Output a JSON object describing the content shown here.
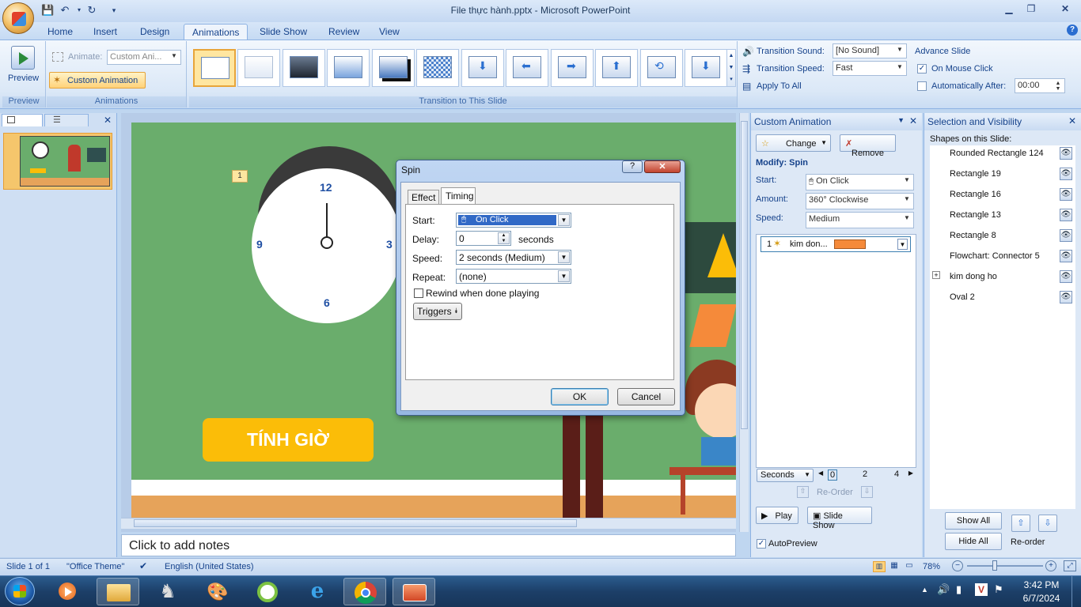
{
  "window": {
    "title": "File thực hành.pptx - Microsoft PowerPoint"
  },
  "tabs": [
    "Home",
    "Insert",
    "Design",
    "Animations",
    "Slide Show",
    "Review",
    "View"
  ],
  "ribbon": {
    "preview_label": "Preview",
    "preview_group": "Preview",
    "animate_label": "Animate:",
    "animate_value": "Custom Ani...",
    "custom_animation_label": "Custom Animation",
    "animations_group": "Animations",
    "transition_group": "Transition to This Slide",
    "transition_sound_label": "Transition Sound:",
    "transition_sound_value": "[No Sound]",
    "transition_speed_label": "Transition Speed:",
    "transition_speed_value": "Fast",
    "apply_all_label": "Apply To All",
    "advance_slide_label": "Advance Slide",
    "on_mouse_click_label": "On Mouse Click",
    "auto_after_label": "Automatically After:",
    "auto_after_value": "00:00"
  },
  "slide_panel": {
    "slide_number": "1"
  },
  "slide": {
    "marker": "1",
    "clock_numbers": {
      "n12": "12",
      "n3": "3",
      "n6": "6",
      "n9": "9"
    },
    "button_text": "TÍNH GIỜ"
  },
  "notes": {
    "placeholder": "Click to add notes"
  },
  "dialog": {
    "title": "Spin",
    "tab_effect": "Effect",
    "tab_timing": "Timing",
    "start_label": "Start:",
    "start_value": "On Click",
    "delay_label": "Delay:",
    "delay_value": "0",
    "delay_unit": "seconds",
    "speed_label": "Speed:",
    "speed_value": "2 seconds (Medium)",
    "repeat_label": "Repeat:",
    "repeat_value": "(none)",
    "rewind_label": "Rewind when done playing",
    "triggers_label": "Triggers",
    "ok_label": "OK",
    "cancel_label": "Cancel"
  },
  "custom_animation": {
    "header": "Custom Animation",
    "change_label": "Change",
    "remove_label": "Remove",
    "modify_label": "Modify: Spin",
    "start_label": "Start:",
    "start_value": "On Click",
    "amount_label": "Amount:",
    "amount_value": "360° Clockwise",
    "speed_label": "Speed:",
    "speed_value": "Medium",
    "list_item_number": "1",
    "list_item_name": "kim don...",
    "timeline_label": "Seconds",
    "timeline_ticks": [
      "0",
      "2",
      "4"
    ],
    "reorder_label": "Re-Order",
    "play_label": "Play",
    "slideshow_label": "Slide Show",
    "autopreview_label": "AutoPreview"
  },
  "selection_visibility": {
    "header": "Selection and Visibility",
    "shapes_label": "Shapes on this Slide:",
    "shapes": [
      "Rounded Rectangle 124",
      "Rectangle 19",
      "Rectangle 16",
      "Rectangle 13",
      "Rectangle 8",
      "Flowchart: Connector 5",
      "kim dong ho",
      "Oval 2"
    ],
    "show_all_label": "Show All",
    "hide_all_label": "Hide All",
    "reorder_label": "Re-order"
  },
  "status": {
    "slide_info": "Slide 1 of 1",
    "theme": "\"Office Theme\"",
    "language": "English (United States)",
    "zoom": "78%"
  },
  "taskbar": {
    "time": "3:42 PM",
    "date": "6/7/2024"
  },
  "colors": {
    "accent": "#15428b",
    "slide_bg": "#6aad6c",
    "button_yellow": "#fbbd08",
    "orange": "#f58a3a"
  }
}
